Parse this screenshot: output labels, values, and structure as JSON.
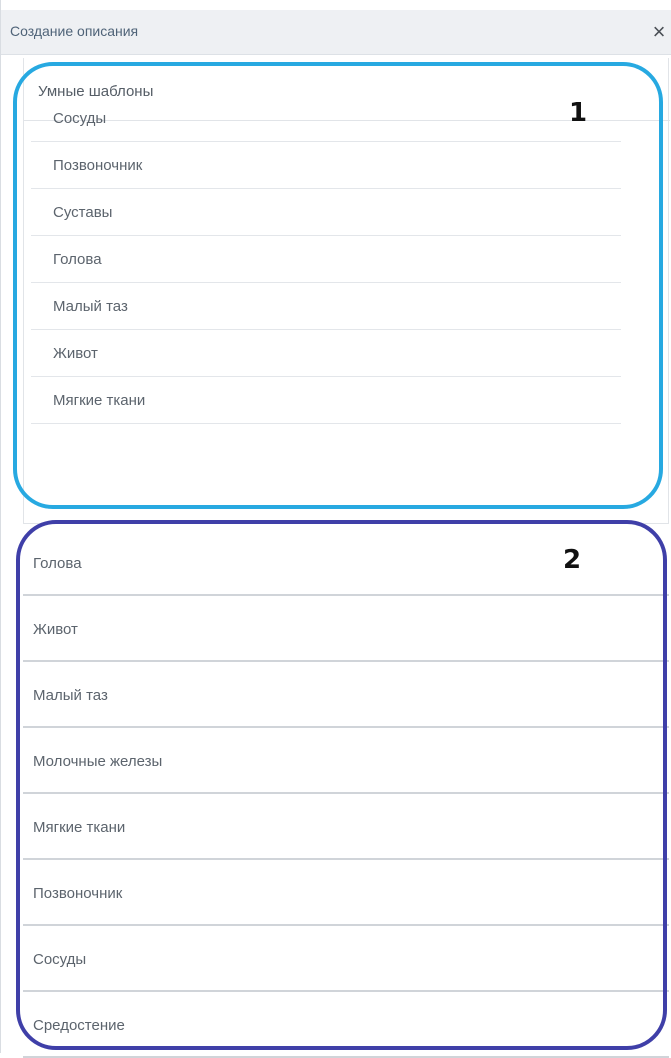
{
  "dialog": {
    "title": "Создание описания",
    "close_label": "×"
  },
  "smart_templates": {
    "header": "Умные шаблоны",
    "items": [
      {
        "label": "Сосуды"
      },
      {
        "label": "Позвоночник"
      },
      {
        "label": "Суставы"
      },
      {
        "label": "Голова"
      },
      {
        "label": "Малый таз"
      },
      {
        "label": "Живот"
      },
      {
        "label": "Мягкие ткани"
      }
    ]
  },
  "organ_list": {
    "items": [
      {
        "label": "Голова"
      },
      {
        "label": "Живот"
      },
      {
        "label": "Малый таз"
      },
      {
        "label": "Молочные железы"
      },
      {
        "label": "Мягкие ткани"
      },
      {
        "label": "Позвоночник"
      },
      {
        "label": "Сосуды"
      },
      {
        "label": "Средостение"
      }
    ]
  },
  "annotations": {
    "marker_1": "1",
    "marker_2": "2",
    "color_1": "#27a9e1",
    "color_2": "#3f3fa8"
  }
}
